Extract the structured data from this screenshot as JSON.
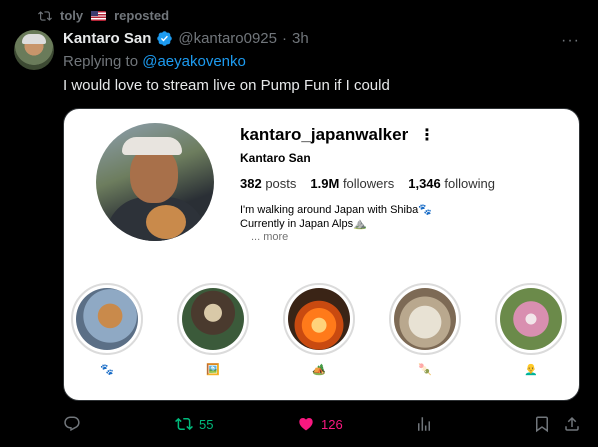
{
  "repost": {
    "user": "toly",
    "label": "reposted"
  },
  "tweet": {
    "author_name": "Kantaro San",
    "handle": "@kantaro0925",
    "dot": "·",
    "time": "3h",
    "more": "···",
    "replying_prefix": "Replying to ",
    "replying_to": "@aeyakovenko",
    "text": "I would love to stream live on Pump Fun if I could"
  },
  "card": {
    "username": "kantaro_japanwalker",
    "menu": "⋮",
    "display_name": "Kantaro San",
    "stats": {
      "posts_value": "382",
      "posts_label": "posts",
      "followers_value": "1.9M",
      "followers_label": "followers",
      "following_value": "1,346",
      "following_label": "following"
    },
    "bio_line1": "I'm walking around Japan with Shiba🐾",
    "bio_line2": "Currently in Japan Alps⛰️",
    "more_label": "... more",
    "highlights": [
      {
        "caption": "🐾"
      },
      {
        "caption": "🖼️"
      },
      {
        "caption": "🏕️"
      },
      {
        "caption": "🍡"
      },
      {
        "caption": "👨‍🦲"
      }
    ]
  },
  "actions": {
    "reply_count": "",
    "repost_count": "55",
    "like_count": "126",
    "repost_color": "#00ba7c",
    "like_color": "#f91880"
  },
  "colors": {
    "accent": "#1d9bf0",
    "background": "#000000",
    "card": "#ffffff"
  }
}
